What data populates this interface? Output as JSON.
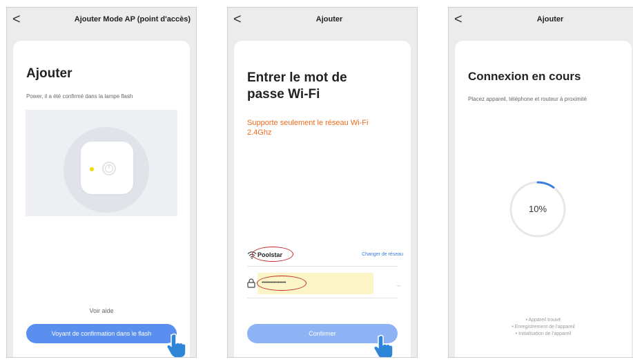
{
  "colors": {
    "accent_blue": "#5a8ff0",
    "warning_orange": "#f06a1c",
    "annotation_red": "#c3262b",
    "progress_blue": "#3b7ddd",
    "highlight_yellow": "#fbf5c8"
  },
  "icons": {
    "back": "chevron-left-icon",
    "wifi": "wifi-icon",
    "lock": "lock-icon",
    "power": "power-icon",
    "hand": "hand-pointer-icon",
    "eye": "eye-icon"
  },
  "screen1": {
    "back_glyph": "<",
    "title": "Ajouter  Mode AP (point d'accès)",
    "heading": "Ajouter",
    "description": "Power, il a été confirmé dans la lampe flash",
    "help_link": "Voir aide",
    "confirm_button": "Voyant de confirmation dans le flash"
  },
  "screen2": {
    "back_glyph": "<",
    "title": "Ajouter",
    "heading_line1": "Entrer le mot de",
    "heading_line2": "passe Wi-Fi",
    "warning_line1": "Supporte seulement le réseau Wi-Fi",
    "warning_line2": "2.4Ghz",
    "ssid": "Poolstar",
    "change_network": "Changer de réseau",
    "password_mask": "••••••••••••••••••",
    "eye_glyph": "⌣",
    "confirm_button": "Confirmer"
  },
  "screen3": {
    "back_glyph": "<",
    "title": "Ajouter",
    "heading": "Connexion en cours",
    "description": "Placez appareil, téléphone et routeur à proximité",
    "progress_percent": 10,
    "progress_label": "10%",
    "steps": [
      {
        "bullet": "•",
        "text": "Appareil trouvé"
      },
      {
        "bullet": "•",
        "text": "Enregistrement de l'appareil"
      },
      {
        "bullet": "•",
        "text": "Initialisation de l'appareil"
      }
    ]
  }
}
